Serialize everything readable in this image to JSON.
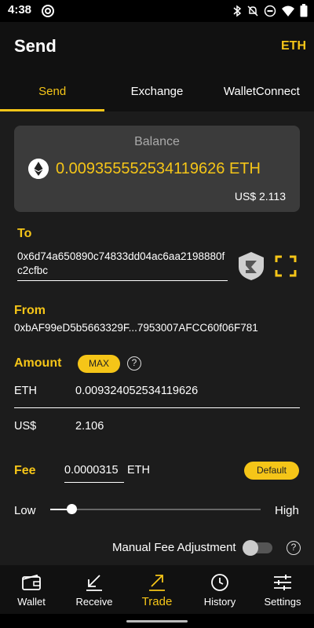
{
  "status": {
    "time": "4:38",
    "icons": [
      "sync-icon",
      "bluetooth-icon",
      "mute-icon",
      "dnd-icon",
      "wifi-icon",
      "battery-icon"
    ]
  },
  "header": {
    "title": "Send",
    "coin": "ETH"
  },
  "tabs": [
    {
      "label": "Send",
      "active": true
    },
    {
      "label": "Exchange",
      "active": false
    },
    {
      "label": "WalletConnect",
      "active": false
    }
  ],
  "balance": {
    "label": "Balance",
    "value": "0.009355552534119626 ETH",
    "fiat": "US$ 2.113",
    "icon": "ethereum-icon"
  },
  "to": {
    "label": "To",
    "address": "0x6d74a650890c74833dd04ac6aa2198880fc2cfbc",
    "icons": [
      "shield-icon",
      "qr-scan-icon"
    ]
  },
  "from": {
    "label": "From",
    "address": "0xbAF99eD5b5663329F...7953007AFCC60f06F781"
  },
  "amount": {
    "label": "Amount",
    "max_label": "MAX",
    "help": "?",
    "eth_unit": "ETH",
    "eth_value": "0.009324052534119626",
    "fiat_unit": "US$",
    "fiat_value": "2.106"
  },
  "fee": {
    "label": "Fee",
    "value": "0.0000315",
    "unit": "ETH",
    "default_label": "Default",
    "low_label": "Low",
    "high_label": "High",
    "slider_level": 0.1
  },
  "manual_fee": {
    "label": "Manual Fee Adjustment",
    "enabled": false,
    "help": "?"
  },
  "nav": [
    {
      "label": "Wallet",
      "icon": "wallet-icon",
      "active": false
    },
    {
      "label": "Receive",
      "icon": "receive-arrow-icon",
      "active": false
    },
    {
      "label": "Trade",
      "icon": "trade-arrow-icon",
      "active": true
    },
    {
      "label": "History",
      "icon": "clock-icon",
      "active": false
    },
    {
      "label": "Settings",
      "icon": "sliders-icon",
      "active": false
    }
  ],
  "colors": {
    "accent": "#f5c518",
    "background": "#1c1c1c",
    "card": "#3b3b3b"
  }
}
